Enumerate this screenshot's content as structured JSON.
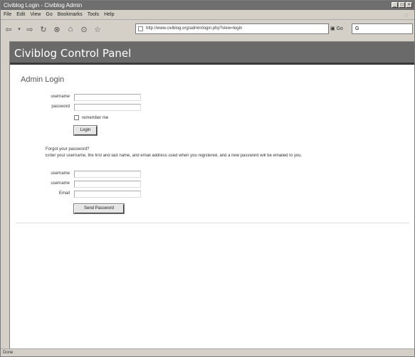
{
  "window": {
    "title": "Civiblog Login - Civiblog Admin",
    "controls": [
      "_",
      "□",
      "×"
    ]
  },
  "menu": [
    "File",
    "Edit",
    "View",
    "Go",
    "Bookmarks",
    "Tools",
    "Help"
  ],
  "toolbar": {
    "back_icon": "back-arrow-icon",
    "forward_icon": "forward-arrow-icon",
    "url": "http://www.civiblog.org/admin/login.php?view=login",
    "go_label": "Go",
    "search_value": "G"
  },
  "banner": {
    "title": "Civiblog Control Panel"
  },
  "login": {
    "heading": "Admin Login",
    "username_label": "username",
    "password_label": "password",
    "remember_label": "remember me",
    "login_button": "Login"
  },
  "forgot": {
    "heading": "Forgot your password?",
    "instructions": "Enter your username, the first and last name, and email address used when you registered, and a new password will be emailed to you.",
    "first_label": "username",
    "second_label": "username",
    "email_label": "Email",
    "send_button": "Send Password"
  },
  "status": {
    "text": "Done"
  }
}
